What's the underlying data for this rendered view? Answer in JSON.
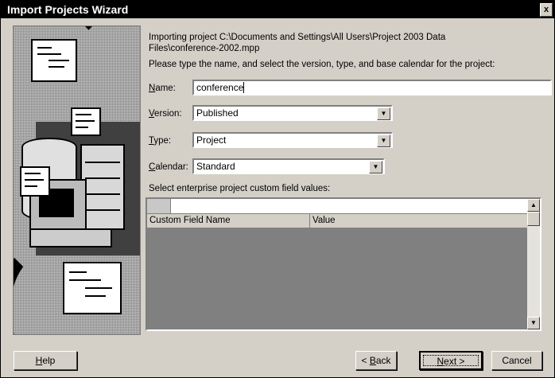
{
  "window": {
    "title": "Import Projects Wizard",
    "close_glyph": "x"
  },
  "intro": {
    "line1": "Importing project C:\\Documents and Settings\\All Users\\Project 2003 Data",
    "line2": "Files\\conference-2002.mpp",
    "instruction": "Please type the name, and select the version, type, and base calendar for the project:"
  },
  "form": {
    "name": {
      "label_key": "N",
      "label_rest": "ame:",
      "value": "conference"
    },
    "version": {
      "label_key": "V",
      "label_rest": "ersion:",
      "value": "Published"
    },
    "type": {
      "label_key": "T",
      "label_rest": "ype:",
      "value": "Project"
    },
    "calendar": {
      "label_key": "C",
      "label_rest": "alendar:",
      "value": "Standard"
    }
  },
  "custom_fields": {
    "caption": "Select enterprise project custom field values:",
    "columns": [
      "Custom Field Name",
      "Value"
    ],
    "rows": []
  },
  "buttons": {
    "help": {
      "pre": "",
      "key": "H",
      "post": "elp"
    },
    "back": {
      "pre": "< ",
      "key": "B",
      "post": "ack"
    },
    "next": {
      "pre": "",
      "key": "N",
      "post": "ext >"
    },
    "cancel": "Cancel"
  },
  "icons": {
    "dropdown": "chevron-down-icon",
    "scroll_up": "scroll-up-icon",
    "scroll_down": "scroll-down-icon"
  },
  "colors": {
    "titlebar": "#000000",
    "dialog": "#d4d0c8"
  }
}
